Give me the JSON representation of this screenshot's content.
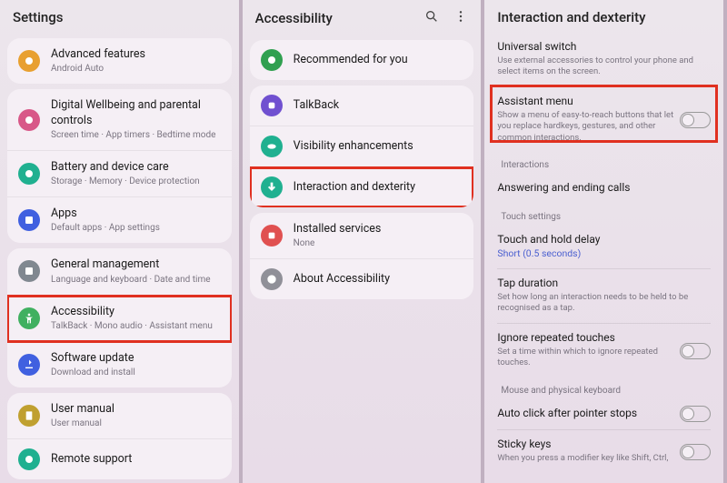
{
  "panel1": {
    "title": "Settings",
    "items": [
      {
        "title": "Advanced features",
        "sub": "Android Auto"
      },
      {
        "title": "Digital Wellbeing and parental controls",
        "sub": "Screen time · App timers · Bedtime mode"
      },
      {
        "title": "Battery and device care",
        "sub": "Storage · Memory · Device protection"
      },
      {
        "title": "Apps",
        "sub": "Default apps · App settings"
      },
      {
        "title": "General management",
        "sub": "Language and keyboard · Date and time"
      },
      {
        "title": "Accessibility",
        "sub": "TalkBack · Mono audio · Assistant menu"
      },
      {
        "title": "Software update",
        "sub": "Download and install"
      },
      {
        "title": "User manual",
        "sub": "User manual"
      },
      {
        "title": "Remote support",
        "sub": ""
      }
    ]
  },
  "panel2": {
    "title": "Accessibility",
    "items": [
      {
        "title": "Recommended for you",
        "sub": ""
      },
      {
        "title": "TalkBack",
        "sub": ""
      },
      {
        "title": "Visibility enhancements",
        "sub": ""
      },
      {
        "title": "Interaction and dexterity",
        "sub": ""
      },
      {
        "title": "Installed services",
        "sub": "None"
      },
      {
        "title": "About Accessibility",
        "sub": ""
      }
    ]
  },
  "panel3": {
    "title": "Interaction and dexterity",
    "universal": {
      "title": "Universal switch",
      "sub": "Use external accessories to control your phone and select items on the screen."
    },
    "assistant": {
      "title": "Assistant menu",
      "sub": "Show a menu of easy-to-reach buttons that let you replace hardkeys, gestures, and other common interactions."
    },
    "sec_interactions": "Interactions",
    "answering": {
      "title": "Answering and ending calls"
    },
    "sec_touch": "Touch settings",
    "touchhold": {
      "title": "Touch and hold delay",
      "link": "Short (0.5 seconds)"
    },
    "tapdur": {
      "title": "Tap duration",
      "sub": "Set how long an interaction needs to be held to be recognised as a tap."
    },
    "ignore": {
      "title": "Ignore repeated touches",
      "sub": "Set a time within which to ignore repeated touches."
    },
    "sec_mouse": "Mouse and physical keyboard",
    "autoclick": {
      "title": "Auto click after pointer stops"
    },
    "sticky": {
      "title": "Sticky keys",
      "sub": "When you press a modifier key like Shift, Ctrl,"
    }
  }
}
